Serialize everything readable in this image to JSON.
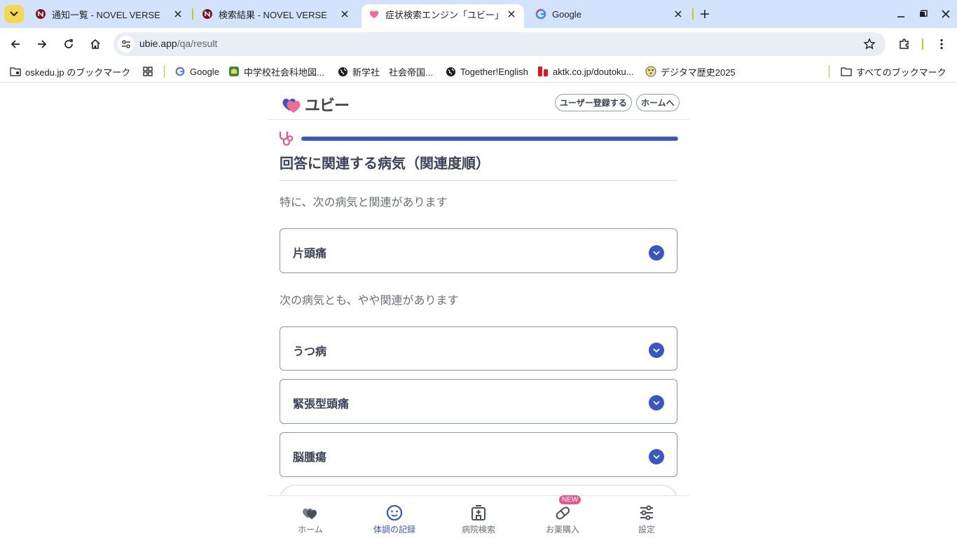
{
  "browser": {
    "tabs": [
      {
        "title": "通知一覧 - NOVEL VERSE",
        "active": false
      },
      {
        "title": "検索結果 - NOVEL VERSE",
        "active": false
      },
      {
        "title": "症状検索エンジン「ユビー」",
        "active": true
      },
      {
        "title": "Google",
        "active": false
      }
    ],
    "url": {
      "domain": "ubie.app",
      "path": "/qa/result"
    },
    "bookmarks": [
      {
        "label": "oskedu.jp のブックマーク",
        "icon": "folder-icon"
      },
      {
        "label": "",
        "icon": "apps-grid-icon"
      },
      {
        "label": "Google",
        "icon": "google-icon"
      },
      {
        "label": "中学校社会科地図...",
        "icon": "school-icon"
      },
      {
        "label": "新学社　社会帝国...",
        "icon": "globe-icon"
      },
      {
        "label": "Together!English",
        "icon": "globe-icon"
      },
      {
        "label": "aktk.co.jp/doutoku...",
        "icon": "red-logo-icon"
      },
      {
        "label": "デジタマ歴史2025",
        "icon": "dotted-logo-icon"
      }
    ],
    "all_bookmarks_label": "すべてのブックマーク"
  },
  "app": {
    "logo_text": "ユビー",
    "header_buttons": {
      "register": "ユーザー登録する",
      "home": "ホームへ"
    },
    "progress": 1.0,
    "section_title": "回答に関連する病気（関連度順）",
    "groups": [
      {
        "heading": "特に、次の病気と関連があります",
        "diseases": [
          "片頭痛"
        ]
      },
      {
        "heading": "次の病気とも、やや関連があります",
        "diseases": [
          "うつ病",
          "緊張型頭痛",
          "脳腫瘍"
        ]
      }
    ],
    "bottom_nav": [
      {
        "label": "ホーム",
        "icon": "heart-home-icon",
        "active": false
      },
      {
        "label": "体調の記録",
        "icon": "smiley-icon",
        "active": true
      },
      {
        "label": "病院検索",
        "icon": "hospital-icon",
        "active": false
      },
      {
        "label": "お薬購入",
        "icon": "pill-icon",
        "active": false,
        "badge": "NEW"
      },
      {
        "label": "設定",
        "icon": "sliders-icon",
        "active": false
      }
    ]
  },
  "colors": {
    "accent": "#3a56c4",
    "tabstrip": "#d3e3fd",
    "badge": "#e8578b",
    "logo_pink": "#f06a9a",
    "logo_blue": "#3a56c4"
  }
}
